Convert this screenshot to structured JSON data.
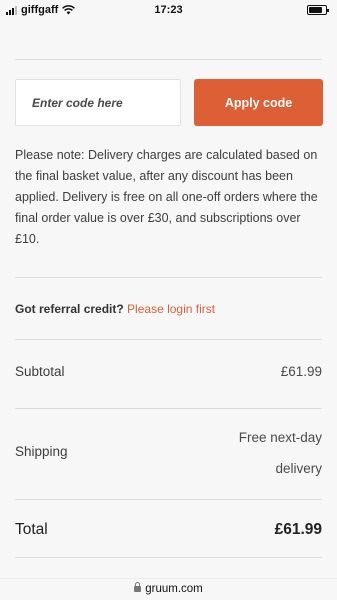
{
  "status_bar": {
    "carrier": "giffgaff",
    "time": "17:23",
    "battery_level": 0.8
  },
  "promo": {
    "placeholder": "Enter code here",
    "apply_label": "Apply code"
  },
  "delivery_note": "Please note: Delivery charges are calculated based on the final basket value, after any discount has been applied. Delivery is free on all one-off orders where the final order value is over £30, and subscriptions over £10.",
  "referral": {
    "question": "Got referral credit?",
    "link_label": "Please login first"
  },
  "summary": {
    "subtotal_label": "Subtotal",
    "subtotal_value": "£61.99",
    "shipping_label": "Shipping",
    "shipping_value": "Free next-day delivery",
    "total_label": "Total",
    "total_value": "£61.99"
  },
  "browser": {
    "url": "gruum.com"
  },
  "colors": {
    "accent": "#dd5f35",
    "background": "#f7f7f7"
  }
}
